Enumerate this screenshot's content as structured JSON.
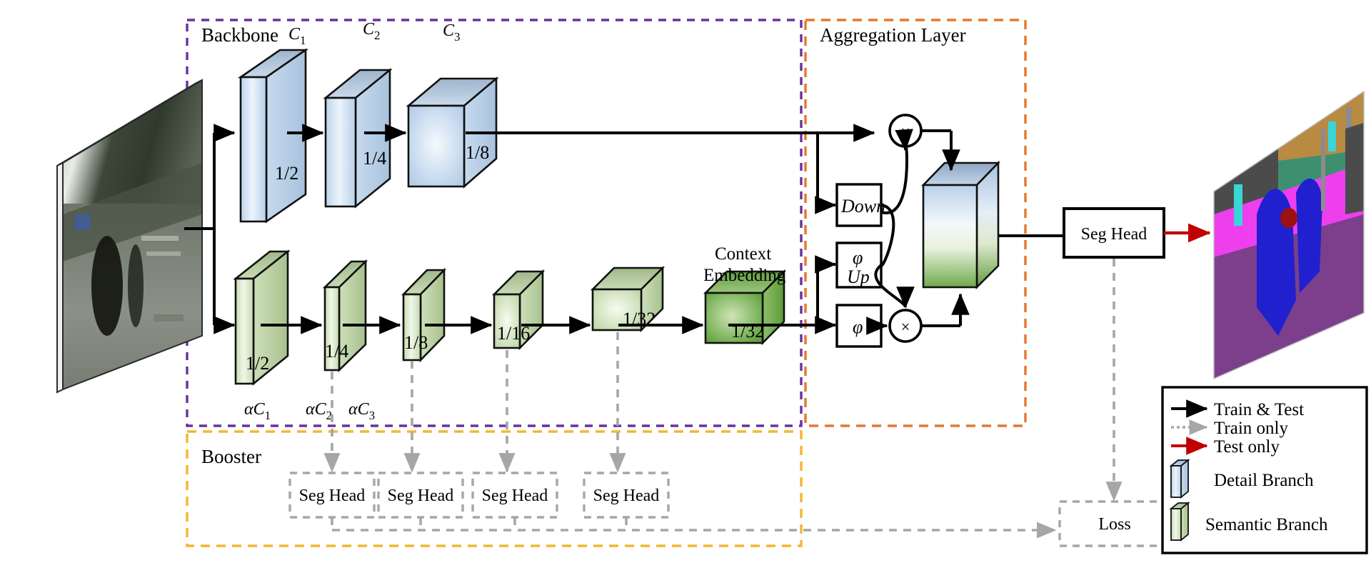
{
  "figure": {
    "type": "neural-network-architecture-diagram",
    "title_blocks": {
      "backbone": "Backbone",
      "aggregation": "Aggregation Layer",
      "booster": "Booster"
    }
  },
  "groups": {
    "backbone": {
      "label": "Backbone",
      "border_color": "#6B2FA0",
      "style": "dashed"
    },
    "aggregation": {
      "label": "Aggregation Layer",
      "border_color": "#E8762C",
      "style": "dashed"
    },
    "booster": {
      "label": "Booster",
      "border_color": "#F2B731",
      "style": "dashed"
    }
  },
  "detail_branch": {
    "name": "Detail Branch",
    "color_top": "#8FA7C4",
    "color_face": "#CFE0F2",
    "blocks": [
      {
        "channel_label": "C",
        "channel_sub": "1",
        "scale": "1/2"
      },
      {
        "channel_label": "C",
        "channel_sub": "2",
        "scale": "1/4"
      },
      {
        "channel_label": "C",
        "channel_sub": "3",
        "scale": "1/8"
      }
    ]
  },
  "semantic_branch": {
    "name": "Semantic Branch",
    "color_top": "#A9BD93",
    "color_face": "#D8E8C8",
    "blocks": [
      {
        "channel_label": "αC",
        "channel_sub": "1",
        "scale": "1/2"
      },
      {
        "channel_label": "αC",
        "channel_sub": "2",
        "scale": "1/4"
      },
      {
        "channel_label": "αC",
        "channel_sub": "3",
        "scale": "1/8"
      },
      {
        "channel_label": "",
        "channel_sub": "",
        "scale": "1/16"
      },
      {
        "channel_label": "",
        "channel_sub": "",
        "scale": "1/32"
      },
      {
        "channel_label": "",
        "channel_sub": "",
        "scale": "1/32",
        "annotation": "Context Embedding"
      }
    ],
    "context_embedding_label_line1": "Context",
    "context_embedding_label_line2": "Embedding"
  },
  "aggregation": {
    "title": "Aggregation Layer",
    "ops": [
      {
        "id": "down",
        "label": "Down"
      },
      {
        "id": "phi-up",
        "label_line1": "φ",
        "label_line2": "Up"
      },
      {
        "id": "phi",
        "label_line1": "φ"
      }
    ],
    "multiply_symbol": "×",
    "fused_block": {
      "name": "fused-feature-cube",
      "color_top": "#8FA7C4",
      "color_face_top": "#CFE0F2",
      "color_face_bottom": "#79B35A"
    }
  },
  "heads": {
    "main_seg_head": "Seg Head",
    "booster_seg_heads": [
      "Seg Head",
      "Seg Head",
      "Seg Head",
      "Seg Head"
    ],
    "loss": "Loss"
  },
  "images": {
    "input": {
      "name": "input-image",
      "description": "street scene photograph"
    },
    "output": {
      "name": "output-segmentation",
      "description": "semantic segmentation map"
    }
  },
  "legend": {
    "items": [
      {
        "id": "train-test",
        "label": "Train & Test",
        "marker": "solid-arrow",
        "color": "#000000"
      },
      {
        "id": "train-only",
        "label": "Train only",
        "marker": "dotted-arrow",
        "color": "#A6A6A6"
      },
      {
        "id": "test-only",
        "label": "Test only",
        "marker": "solid-arrow",
        "color": "#C00000"
      },
      {
        "id": "detail-branch",
        "label": "Detail Branch",
        "marker": "blue-slab",
        "color": "#CFE0F2"
      },
      {
        "id": "semantic-branch",
        "label": "Semantic Branch",
        "marker": "green-slab",
        "color": "#D8E8C8"
      }
    ]
  },
  "colors": {
    "backbone_border": "#6B2FA0",
    "aggregation_border": "#E8762C",
    "booster_border": "#F2B731",
    "train_only": "#A6A6A6",
    "test_only": "#C00000",
    "train_test": "#000000"
  }
}
